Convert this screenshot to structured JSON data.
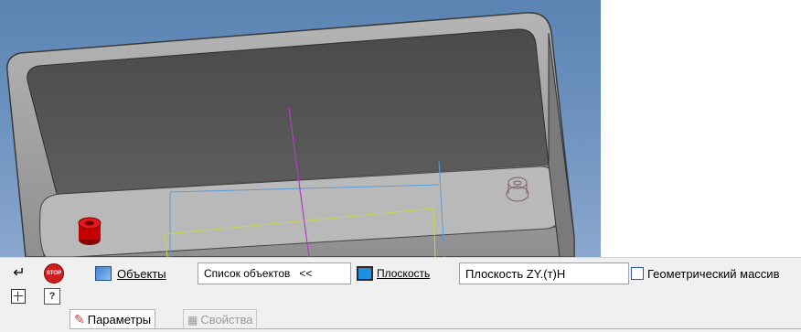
{
  "panel": {
    "objects_label": "Объекты",
    "object_list_label": "Список объектов",
    "collapse_label": "<<",
    "plane_label": "Плоскость",
    "plane_value": "Плоскость ZY.(т)Н",
    "geometric_array_label": "Геометрический массив"
  },
  "tabs": {
    "parameters": "Параметры",
    "properties": "Свойства"
  },
  "left_icons": [
    "enter-icon",
    "stop-icon",
    "grid-snap-icon",
    "help-icon"
  ]
}
